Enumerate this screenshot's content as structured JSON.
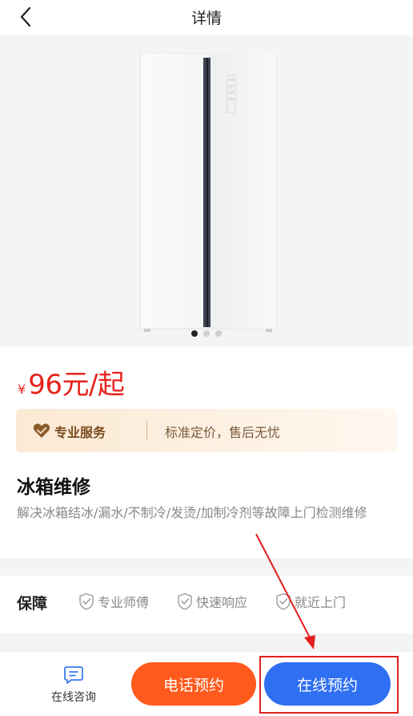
{
  "header": {
    "title": "详情",
    "back_icon": "chevron-left-icon"
  },
  "product_image": {
    "carousel_total": 3,
    "carousel_active": 1
  },
  "price": {
    "currency": "¥",
    "amount": "96元/起"
  },
  "service_tag": {
    "icon": "heart-icon",
    "label": "专业服务",
    "description": "标准定价，售后无忧"
  },
  "service": {
    "title": "冰箱维修",
    "description": "解决冰箱结冰/漏水/不制冷/发烫/加制冷剂等故障上门检测维修"
  },
  "guarantee": {
    "label": "保障",
    "items": [
      {
        "icon": "shield-check-icon",
        "text": "专业师傅"
      },
      {
        "icon": "shield-check-icon",
        "text": "快速响应"
      },
      {
        "icon": "shield-check-icon",
        "text": "就近上门"
      }
    ]
  },
  "bottom_bar": {
    "consult_label": "在线咨询",
    "consult_icon": "chat-icon",
    "phone_button": "电话预约",
    "online_button": "在线预约"
  },
  "colors": {
    "price": "#e8231c",
    "phone_button": "#ff5a1e",
    "online_button": "#2f6ff2",
    "annotation": "#e21f1f"
  }
}
